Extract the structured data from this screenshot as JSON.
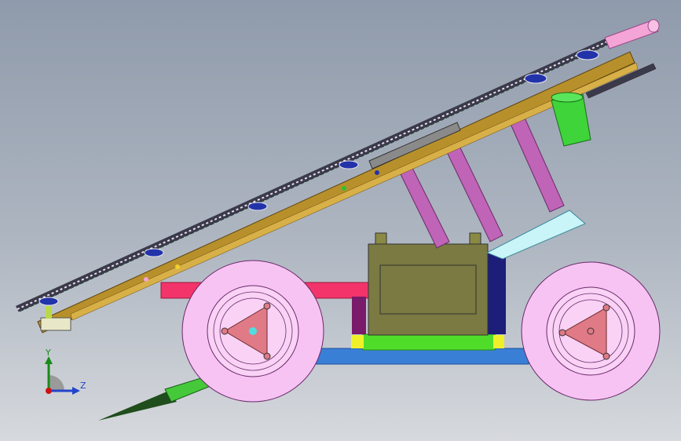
{
  "view": {
    "background_top": "#8f9aab",
    "background_bottom": "#d6d9dd"
  },
  "model": {
    "colors": {
      "rail": "#b8902b",
      "belt": "#3a3a4a",
      "strut": "#c064b8",
      "wheel_tire": "#f7c3f3",
      "hub_triangle": "#e07a86",
      "battery_box": "#7a7a42",
      "base_plate": "#3a7fd6",
      "green_bar": "#4fdd2a",
      "red_bar": "#f2346a",
      "navy_post": "#1d1d7a",
      "cyan_bracket": "#c9f5f8",
      "motor": "#3ed43a",
      "pink_tube": "#f4a4d6",
      "probe": "#1f4d1c"
    }
  },
  "triad": {
    "y_label": "Y",
    "z_label": "Z",
    "y_color": "#1a8a1a",
    "z_color": "#2244cc",
    "x_color": "#cc1111"
  }
}
